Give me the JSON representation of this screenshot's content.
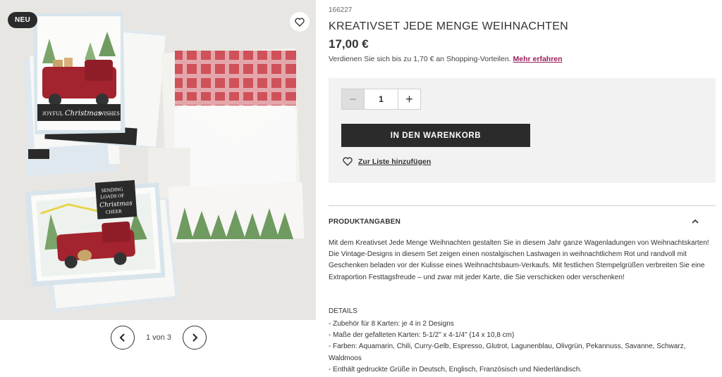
{
  "gallery": {
    "badge": "NEU",
    "pager_text": "1 von 3",
    "scene": {
      "card_text_1": "JOYFUL",
      "card_script_1": "Christmas",
      "card_text_2": "WISHES",
      "card_text_3": "SENDING",
      "card_text_4": "LOADS OF",
      "card_script_2": "Christmas",
      "card_text_5": "CHEER"
    }
  },
  "product": {
    "sku": "166227",
    "title": "KREATIVSET JEDE MENGE WEIHNACHTEN",
    "price": "17,00 €",
    "earn_text": "Verdienen Sie sich bis zu 1,70 € an Shopping-Vorteilen.",
    "earn_link": "Mehr erfahren"
  },
  "buybox": {
    "minus": "−",
    "quantity": "1",
    "plus": "+",
    "cart_button": "IN DEN WARENKORB",
    "list_link": "Zur Liste hinzufügen"
  },
  "info": {
    "section_title": "PRODUKTANGABEN",
    "description": "Mit dem Kreativset Jede Menge Weihnachten gestalten Sie in diesem Jahr ganze Wagenladungen von Weihnachtskarten! Die Vintage-Designs in diesem Set zeigen einen nostalgischen Lastwagen in weihnachtlichem Rot und randvoll mit Geschenken beladen vor der Kulisse eines Weihnachtsbaum-Verkaufs. Mit festlichen Stempelgrüßen verbreiten Sie eine Extraportion Festtagsfreude – und zwar mit jeder Karte, die Sie verschicken oder verschenken!",
    "details_title": "DETAILS",
    "details": [
      "- Zubehör für 8 Karten: je 4 in 2 Designs",
      "- Maße der gefalteten Karten: 5-1/2\" x 4-1/4\" (14 x 10,8 cm)",
      "- Farben: Aquamarin, Chili, Curry-Gelb, Espresso, Glutrot, Lagunenblau, Olivgrün, Pekannuss, Savanne, Schwarz, Waldmoos",
      "- Enthält gedruckte Grüße in Deutsch, Englisch, Französisch und Niederländisch."
    ]
  },
  "colors": {
    "dark": "#2b2b2b",
    "link": "#9b1e5c",
    "truck_red": "#a3232e",
    "buybox_bg": "#f2f2f2"
  },
  "icons": {
    "wishlist": "heart-icon",
    "prev": "chevron-left-icon",
    "next": "chevron-right-icon",
    "collapse": "chevron-up-icon"
  }
}
